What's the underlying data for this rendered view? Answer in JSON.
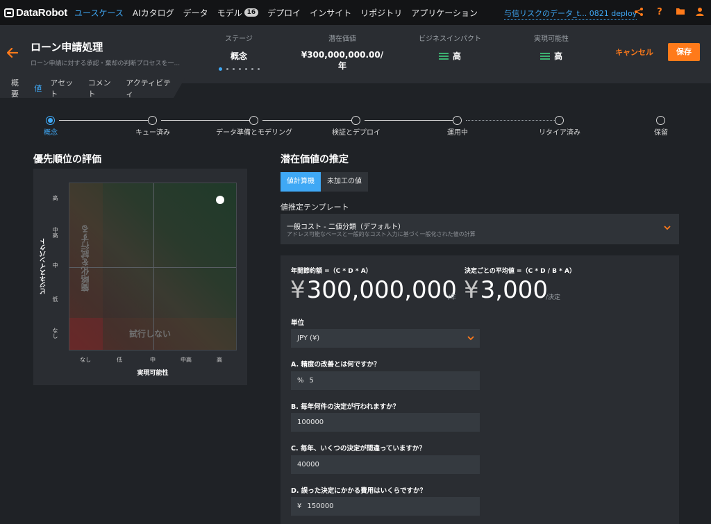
{
  "nav": {
    "logo_data": "Data",
    "logo_robot": "Robot",
    "items": [
      {
        "label": "ユースケース",
        "active": true
      },
      {
        "label": "AIカタログ"
      },
      {
        "label": "データ"
      },
      {
        "label": "モデル",
        "badge": "16"
      },
      {
        "label": "デプロイ"
      },
      {
        "label": "インサイト"
      },
      {
        "label": "リポジトリ"
      },
      {
        "label": "アプリケーション"
      }
    ],
    "deployment": "与信リスクのデータ_t... 0821 deploy",
    "icons": [
      "share-icon",
      "help-icon",
      "folder-icon",
      "user-icon"
    ]
  },
  "header": {
    "title": "ローン申請処理",
    "subtitle": "ローン申請に対する承認・棄却の判断プロセスを一...",
    "stage_label": "ステージ",
    "stage_value": "概念",
    "potential_label": "潜在価値",
    "potential_value": "¥300,000,000.00/年",
    "impact_label": "ビジネスインパクト",
    "impact_value": "高",
    "feasibility_label": "実現可能性",
    "feasibility_value": "高",
    "cancel": "キャンセル",
    "save": "保存"
  },
  "tabs": [
    "概要",
    "値",
    "アセット",
    "コメント",
    "アクティビティ"
  ],
  "active_tab": "値",
  "stepper": [
    {
      "label": "概念",
      "active": true
    },
    {
      "label": "キュー済み"
    },
    {
      "label": "データ準備とモデリング"
    },
    {
      "label": "検証とデプロイ"
    },
    {
      "label": "運用中"
    },
    {
      "label": "リタイア済み"
    },
    {
      "label": "保留"
    }
  ],
  "priority": {
    "title": "優先順位の評価",
    "y_axis_label": "ビジネスインパクト",
    "x_axis_label": "実現可能性",
    "y_ticks": [
      "高",
      "中高",
      "中",
      "低",
      "なし"
    ],
    "x_ticks": [
      "なし",
      "低",
      "中",
      "中高",
      "高"
    ],
    "zone_simplify": "簡略化を試行する",
    "zone_skip": "試行しない",
    "point": {
      "feasibility": "高",
      "impact": "高"
    }
  },
  "estimate": {
    "title": "潜在価値の推定",
    "mode_calculator": "値計算機",
    "mode_raw": "未加工の値",
    "template_label": "値推定テンプレート",
    "template_name": "一般コスト - 二値分類（デフォルト）",
    "template_desc": "アドレス可能なベースと一般的なコスト入力に基づく一般化された値の計算",
    "annual_formula": "年間節約額 =（C * D * A）",
    "annual_currency": "¥",
    "annual_value": "300,000,000",
    "annual_unit": "/年",
    "per_decision_formula": "決定ごとの平均値 =（C * D / B * A）",
    "per_decision_currency": "¥",
    "per_decision_value": "3,000",
    "per_decision_unit": "/決定",
    "unit_label": "単位",
    "unit_value": "JPY (¥)",
    "qa_label": "A. 精度の改善とは何ですか？",
    "qa_prefix": "%",
    "qa_value": "5",
    "qb_label": "B. 毎年何件の決定が行われますか？",
    "qb_value": "100000",
    "qc_label": "C. 毎年、いくつの決定が間違っていますか？",
    "qc_value": "40000",
    "qd_label": "D. 誤った決定にかかる費用はいくらですか？",
    "qd_prefix": "¥",
    "qd_value": "150000"
  }
}
